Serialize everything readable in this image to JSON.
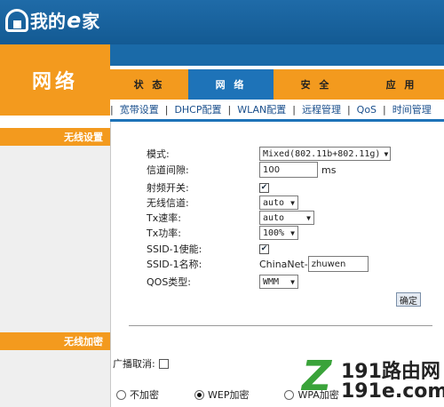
{
  "brand": {
    "text_a": "我的",
    "text_e": "e",
    "text_b": "家"
  },
  "section_title": "网络",
  "tabs": [
    {
      "label": "状 态",
      "active": false
    },
    {
      "label": "网 络",
      "active": true
    },
    {
      "label": "安 全",
      "active": false
    },
    {
      "label": "应 用",
      "active": false
    }
  ],
  "subnav": [
    "宽带设置",
    "DHCP配置",
    "WLAN配置",
    "远程管理",
    "QoS",
    "时间管理"
  ],
  "left_sections": {
    "wireless_settings": "无线设置",
    "wireless_encryption": "无线加密"
  },
  "form": {
    "mode": {
      "label": "模式:",
      "value": "Mixed(802.11b+802.11g)"
    },
    "beacon": {
      "label": "信道间隙:",
      "value": "100",
      "unit": "ms"
    },
    "rf_switch": {
      "label": "射频开关:",
      "checked": true
    },
    "channel": {
      "label": "无线信道:",
      "value": "auto"
    },
    "tx_rate": {
      "label": "Tx速率:",
      "value": "auto"
    },
    "tx_power": {
      "label": "Tx功率:",
      "value": "100%"
    },
    "ssid1_enable": {
      "label": "SSID-1使能:",
      "checked": true
    },
    "ssid1_name": {
      "label": "SSID-1名称:",
      "prefix": "ChinaNet-",
      "value": "zhuwen"
    },
    "qos_type": {
      "label": "QOS类型:",
      "value": "WMM"
    },
    "confirm_button": "确定"
  },
  "broadcast_cancel": {
    "label": "广播取消:",
    "checked": false
  },
  "encryption_options": [
    {
      "label": "不加密",
      "selected": false
    },
    {
      "label": "WEP加密",
      "selected": true
    },
    {
      "label": "WPA加密",
      "selected": false
    }
  ],
  "watermark": {
    "line1": "191路由网",
    "line2": "191e.com"
  }
}
